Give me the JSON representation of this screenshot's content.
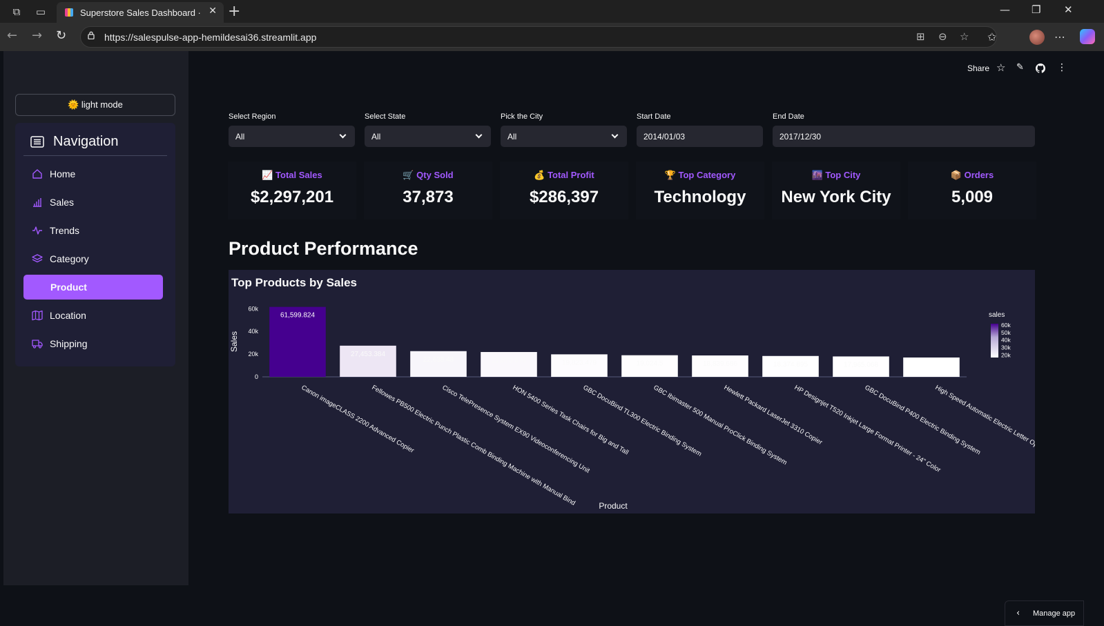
{
  "browser": {
    "tab_title": "Superstore Sales Dashboard · Streamlit",
    "url": "https://salespulse-app-hemildesai36.streamlit.app",
    "window_controls": [
      "minimize",
      "restore",
      "close"
    ]
  },
  "sidebar": {
    "mode_button": "🌞 light mode",
    "nav_title": "Navigation",
    "items": [
      {
        "label": "Home",
        "icon": "home-icon",
        "active": false
      },
      {
        "label": "Sales",
        "icon": "bar-chart-icon",
        "active": false
      },
      {
        "label": "Trends",
        "icon": "activity-icon",
        "active": false
      },
      {
        "label": "Category",
        "icon": "layers-icon",
        "active": false
      },
      {
        "label": "Product",
        "icon": "box-icon",
        "active": true
      },
      {
        "label": "Location",
        "icon": "map-icon",
        "active": false
      },
      {
        "label": "Shipping",
        "icon": "truck-icon",
        "active": false
      }
    ],
    "accent": "#a259ff"
  },
  "toolbar": {
    "share_label": "Share"
  },
  "filters": [
    {
      "label": "Select Region",
      "value": "All",
      "dropdown": true
    },
    {
      "label": "Select State",
      "value": "All",
      "dropdown": true
    },
    {
      "label": "Pick the City",
      "value": "All",
      "dropdown": true
    },
    {
      "label": "Start Date",
      "value": "2014/01/03",
      "dropdown": false
    },
    {
      "label": "End Date",
      "value": "2017/12/30",
      "dropdown": false
    }
  ],
  "kpis": [
    {
      "label": "📈 Total Sales",
      "value": "$2,297,201"
    },
    {
      "label": "🛒 Qty Sold",
      "value": "37,873"
    },
    {
      "label": "💰 Total Profit",
      "value": "$286,397"
    },
    {
      "label": "🏆 Top Category",
      "value": "Technology"
    },
    {
      "label": "🌆 Top City",
      "value": "New York City"
    },
    {
      "label": "📦 Orders",
      "value": "5,009"
    }
  ],
  "section_title": "Product Performance",
  "chart_data": {
    "type": "bar",
    "title": "Top Products by Sales",
    "xlabel": "Product",
    "ylabel": "Sales",
    "ylim": [
      0,
      62000
    ],
    "yticks": [
      0,
      20000,
      40000,
      60000
    ],
    "ytick_labels": [
      "0",
      "20k",
      "40k",
      "60k"
    ],
    "categories": [
      "Canon imageCLASS 2200 Advanced Copier",
      "Fellowes PB500 Electric Punch Plastic Comb Binding Machine with Manual Bind",
      "Cisco TelePresence System EX90 Videoconferencing Unit",
      "HON 5400 Series Task Chairs for Big and Tall",
      "GBC DocuBind TL300 Electric Binding System",
      "GBC Ibimaster 500 Manual ProClick Binding System",
      "Hewlett Packard LaserJet 3310 Copier",
      "HP Designjet T520 Inkjet Large Format Printer - 24\" Color",
      "GBC DocuBind P400 Electric Binding System",
      "High Speed Automatic Electric Letter Opener"
    ],
    "values": [
      61599.824,
      27453.384,
      22638.48,
      21870.576,
      19823.479,
      19024.5,
      18839.686,
      18374.895,
      17965.068,
      17030.312
    ],
    "labels": [
      "61,599.824",
      "27,453.384",
      "22,638.48",
      "21,870.576",
      "19,823.479",
      "19,024.5",
      "18,839.686",
      "18,374.895",
      "17,965.068",
      ""
    ],
    "colorbar": {
      "title": "sales",
      "tick_labels": [
        "60k",
        "50k",
        "40k",
        "30k",
        "20k"
      ],
      "tick_values": [
        60000,
        50000,
        40000,
        30000,
        20000
      ],
      "min": 17030,
      "max": 61600,
      "low_color": "#ffffff",
      "high_color": "#45008f"
    },
    "legend": "right"
  },
  "manage_app": "Manage app"
}
